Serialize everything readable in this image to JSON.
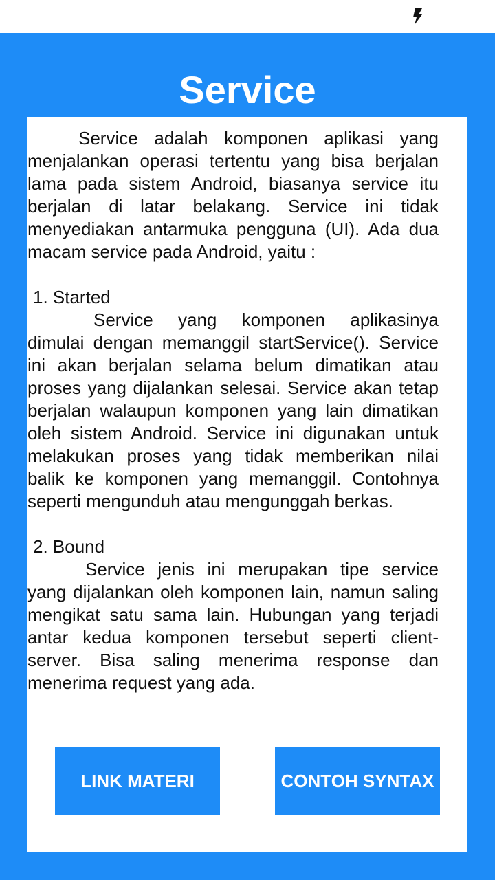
{
  "status_bar": {
    "icons": [
      "charging-icon"
    ],
    "icon_color": "#111111"
  },
  "colors": {
    "accent": "#1e8cf7",
    "card": "#ffffff",
    "text": "#111111"
  },
  "page": {
    "title": "Service"
  },
  "content": {
    "intro": "Service adalah komponen aplikasi yang menjalankan operasi tertentu yang bisa berjalan lama pada sistem Android, biasanya service itu berjalan di latar belakang. Service ini tidak menyediakan antarmuka pengguna (UI). Ada dua macam service pada Android, yaitu :",
    "section1_heading": "1. Started",
    "section1_body": "Service yang komponen aplikasinya dimulai dengan memanggil startService(). Service ini akan berjalan selama belum dimatikan atau proses yang dijalankan selesai. Service akan tetap berjalan walaupun komponen yang lain dimatikan oleh sistem Android. Service ini digunakan untuk melakukan proses yang tidak memberikan nilai balik ke komponen yang memanggil. Contohnya seperti mengunduh atau mengunggah berkas.",
    "section2_heading": "2. Bound",
    "section2_body": "Service jenis ini merupakan tipe service yang dijalankan oleh komponen lain, namun saling mengikat satu sama lain. Hubungan yang terjadi antar kedua komponen tersebut seperti client-server. Bisa saling menerima response dan menerima request yang ada."
  },
  "buttons": {
    "link_materi": "LINK MATERI",
    "contoh_syntax": "CONTOH SYNTAX"
  }
}
